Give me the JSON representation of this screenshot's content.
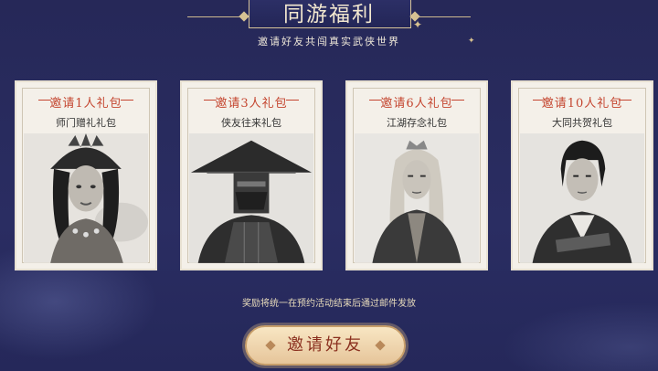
{
  "header": {
    "title": "同游福利",
    "subtitle": "邀请好友共闯真实武侠世界"
  },
  "cards": [
    {
      "title": "邀请1人礼包",
      "subtitle": "师门赠礼礼包",
      "portrait": "woman-with-headdress"
    },
    {
      "title": "邀请3人礼包",
      "subtitle": "侠友往来礼包",
      "portrait": "masked-swordsman-with-straw-hat"
    },
    {
      "title": "邀请6人礼包",
      "subtitle": "江湖存念礼包",
      "portrait": "long-haired-man-with-crown"
    },
    {
      "title": "邀请10人礼包",
      "subtitle": "大同共贺礼包",
      "portrait": "young-swordsman"
    }
  ],
  "note": "奖励将统一在预约活动结束后通过邮件发放",
  "invite_button": {
    "label": "邀请好友"
  },
  "colors": {
    "background": "#26295a",
    "accent_red": "#c4452f",
    "gold": "#d7c49a"
  }
}
